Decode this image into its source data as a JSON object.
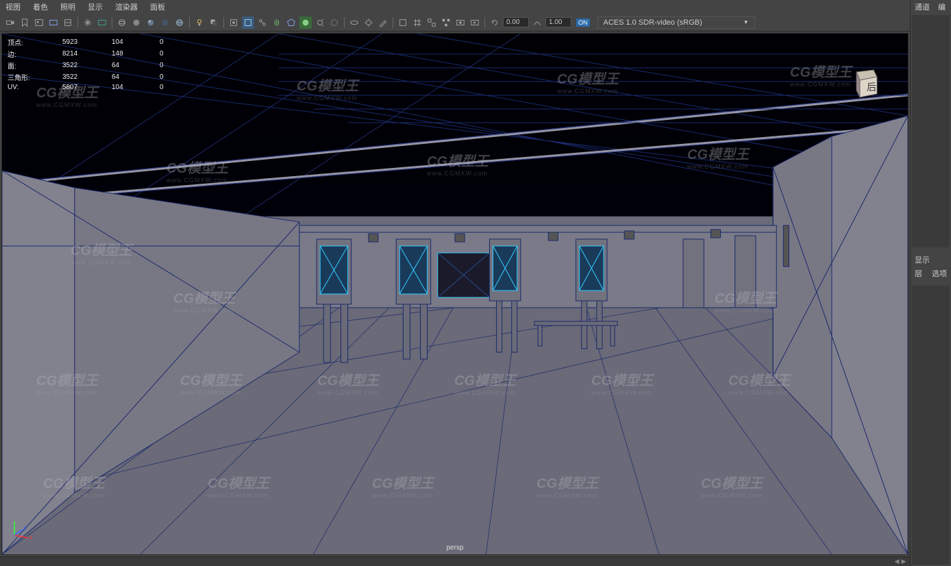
{
  "menu": {
    "view": "视图",
    "shading": "着色",
    "lighting": "照明",
    "show": "显示",
    "renderer": "渲染器",
    "panels": "面板"
  },
  "toolbar": {
    "val1": "0.00",
    "val2": "1.00",
    "on_label": "ON",
    "color_space": "ACES 1.0 SDR-video (sRGB)"
  },
  "stats": {
    "rows": [
      {
        "label": "顶点:",
        "c1": "5923",
        "c2": "104",
        "c3": "0"
      },
      {
        "label": "边:",
        "c1": "8214",
        "c2": "148",
        "c3": "0"
      },
      {
        "label": "面:",
        "c1": "3522",
        "c2": "64",
        "c3": "0"
      },
      {
        "label": "三角形:",
        "c1": "3522",
        "c2": "64",
        "c3": "0"
      },
      {
        "label": "UV:",
        "c1": "5807",
        "c2": "104",
        "c3": "0"
      }
    ]
  },
  "viewport": {
    "camera": "persp",
    "gizmo_label": "后",
    "axes": {
      "x": "x",
      "z": "z"
    }
  },
  "watermark": {
    "brand": "CG模型王",
    "url": "www.CGMXW.com"
  },
  "right_panel": {
    "tab_channel": "通道",
    "tab_edit": "编",
    "sec_display": "显示",
    "sec_layer": "层",
    "sec_options": "选项"
  }
}
